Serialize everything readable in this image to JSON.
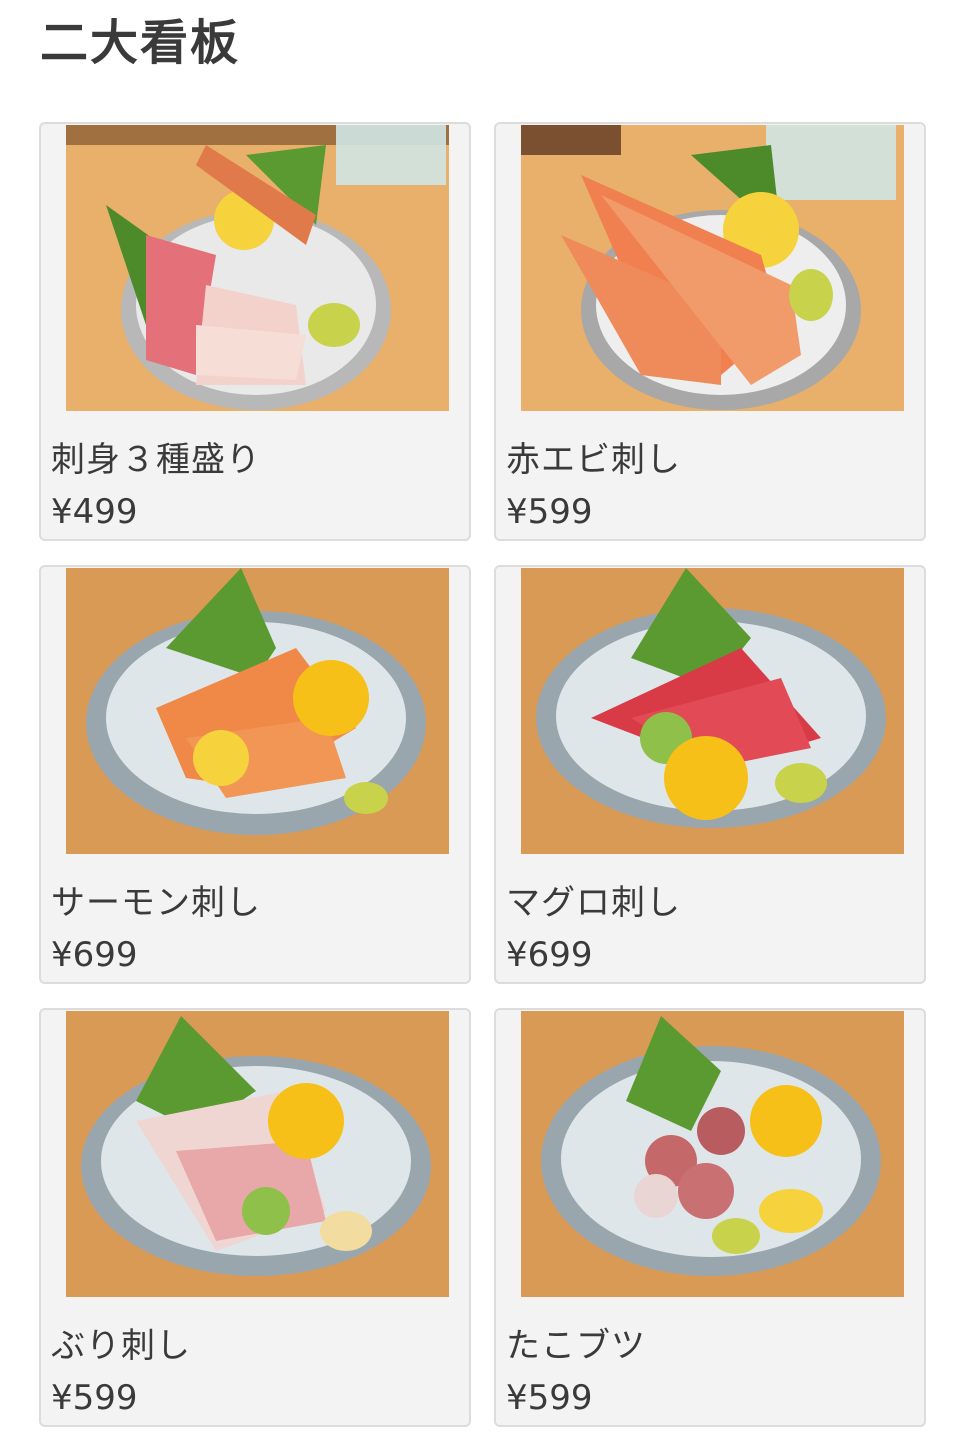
{
  "section": {
    "title": "二大看板"
  },
  "menu_items": [
    {
      "name": "刺身３種盛り",
      "price": "¥499",
      "photo": "sashimi-platter-photo"
    },
    {
      "name": "赤エビ刺し",
      "price": "¥599",
      "photo": "red-shrimp-sashimi-photo"
    },
    {
      "name": "サーモン刺し",
      "price": "¥699",
      "photo": "salmon-sashimi-photo"
    },
    {
      "name": "マグロ刺し",
      "price": "¥699",
      "photo": "tuna-sashimi-photo"
    },
    {
      "name": "ぶり刺し",
      "price": "¥599",
      "photo": "yellowtail-sashimi-photo"
    },
    {
      "name": "たこブツ",
      "price": "¥599",
      "photo": "octopus-chunks-photo"
    }
  ],
  "colors": {
    "card_bg": "#f3f3f3",
    "card_border": "#dcdcdc",
    "text": "#3a3a3a",
    "table_wood": "#d99a55"
  }
}
